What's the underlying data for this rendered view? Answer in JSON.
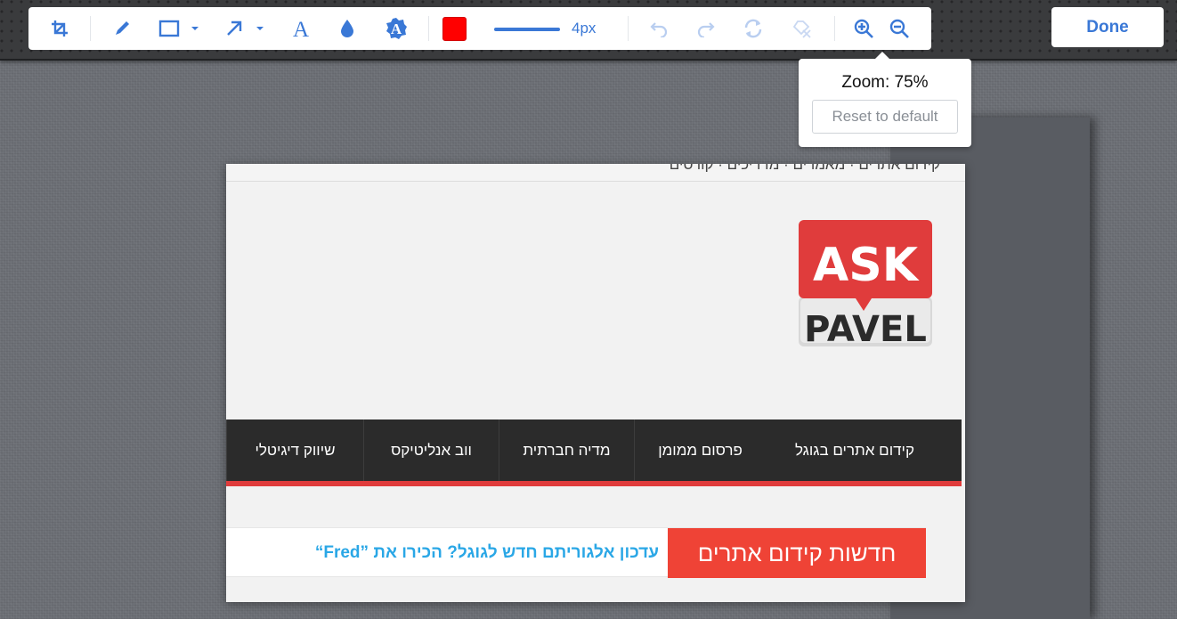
{
  "toolbar": {
    "tools": [
      {
        "name": "crop",
        "icon": "crop-icon"
      },
      {
        "name": "pen",
        "icon": "pen-icon"
      },
      {
        "name": "rectangle",
        "icon": "rectangle-icon",
        "dropdown": true
      },
      {
        "name": "arrow",
        "icon": "arrow-icon",
        "dropdown": true
      },
      {
        "name": "text",
        "icon": "text-icon"
      },
      {
        "name": "blur",
        "icon": "water-drop-icon"
      },
      {
        "name": "text-highlight",
        "icon": "badge-text-icon"
      }
    ],
    "color": "#ff0000",
    "line_size_label": "4px",
    "history": [
      "undo-icon",
      "redo-icon",
      "refresh-icon",
      "clear-icon"
    ],
    "zoom_icons": [
      "zoom-in-icon",
      "zoom-out-icon"
    ],
    "accent": "#3a78d6"
  },
  "done_label": "Done",
  "zoom_popup": {
    "label": "Zoom: 75%",
    "reset_label": "Reset to default",
    "zoom_percent": 75
  },
  "screenshot": {
    "cut_top_text": "קידום אתרים · מאמרים · מדריכים · קורסים",
    "logo": {
      "line1": "ASK",
      "line2": "PAVEL",
      "color": "#e03c3c"
    },
    "nav_items": [
      "קידום אתרים בגוגל",
      "פרסום ממומן",
      "מדיה חברתית",
      "ווב אנליטיקס",
      "שיווק דיגיטלי"
    ],
    "news_tag": "חדשות קידום אתרים",
    "news_text": "עדכון אלגוריתם חדש לגוגל? הכירו את ”Fred“"
  }
}
